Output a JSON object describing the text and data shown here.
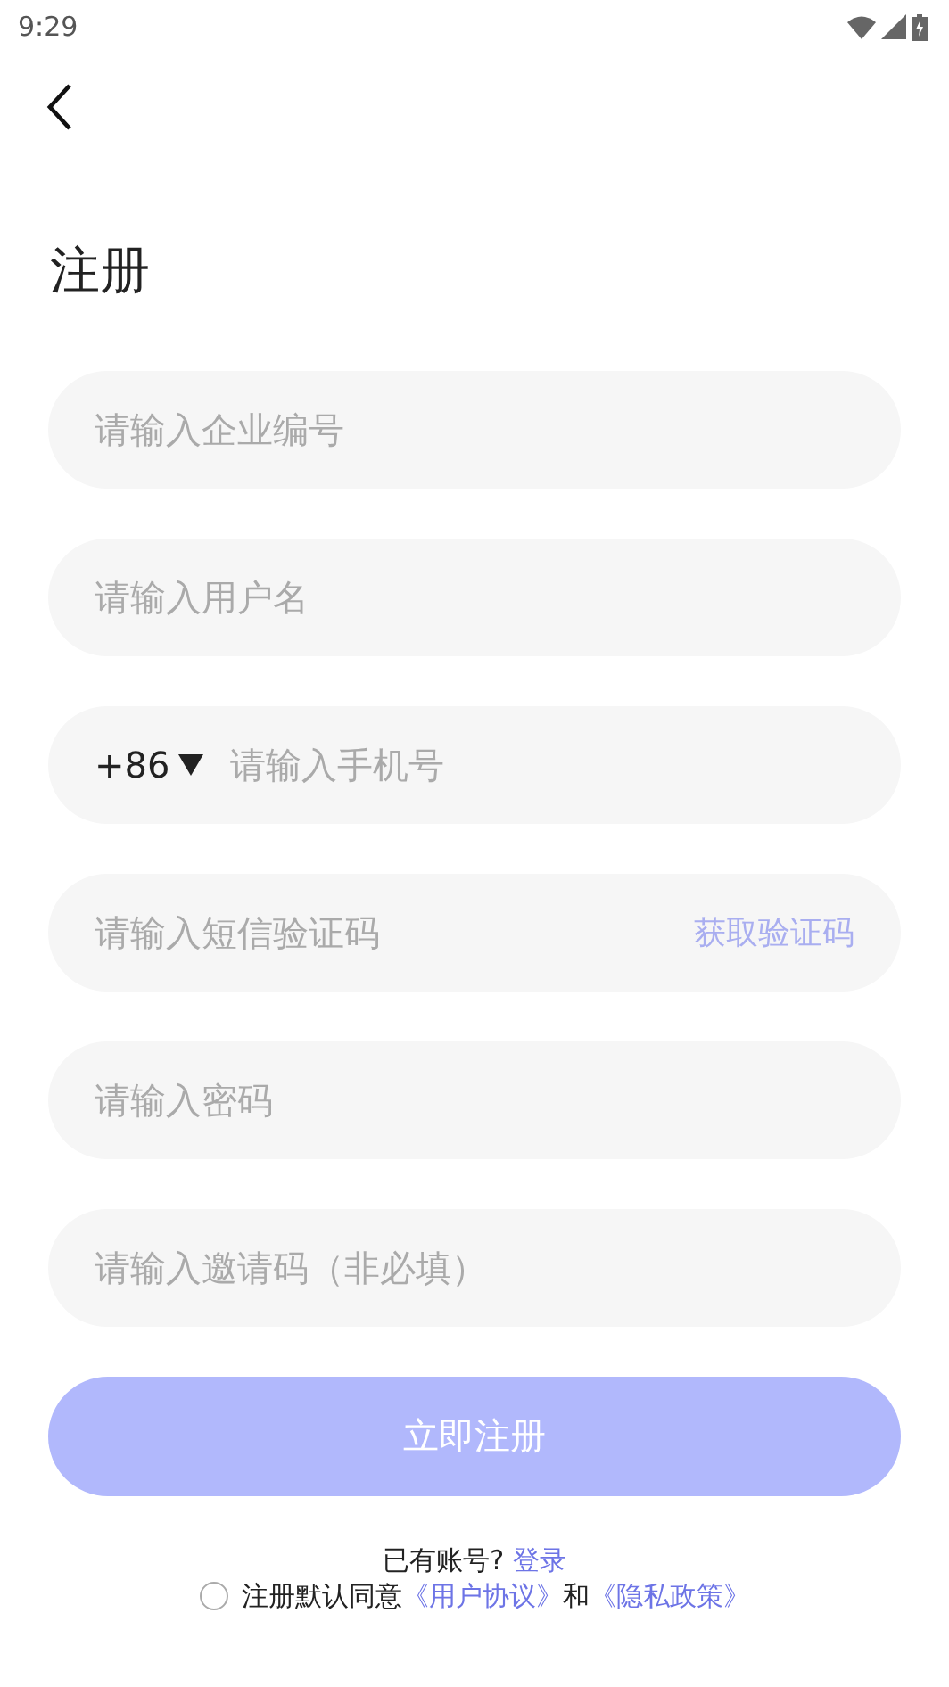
{
  "status_bar": {
    "time": "9:29"
  },
  "title": "注册",
  "fields": [
    {
      "kind": "plain",
      "placeholder": "请输入企业编号"
    },
    {
      "kind": "plain",
      "placeholder": "请输入用户名"
    },
    {
      "kind": "phone",
      "prefix": "+86",
      "placeholder": "请输入手机号"
    },
    {
      "kind": "code",
      "placeholder": "请输入短信验证码",
      "action": "获取验证码"
    },
    {
      "kind": "password",
      "placeholder": "请输入密码"
    },
    {
      "kind": "plain",
      "placeholder": "请输入邀请码（非必填）"
    }
  ],
  "submit": {
    "label": "立即注册",
    "disabled": true
  },
  "login_prompt": {
    "text": "已有账号?",
    "link": "登录"
  },
  "agreement": {
    "checked": false,
    "text": "注册默认同意",
    "link_1": "《用户协议》",
    "joiner": "和",
    "link_2": "《隐私政策》"
  }
}
